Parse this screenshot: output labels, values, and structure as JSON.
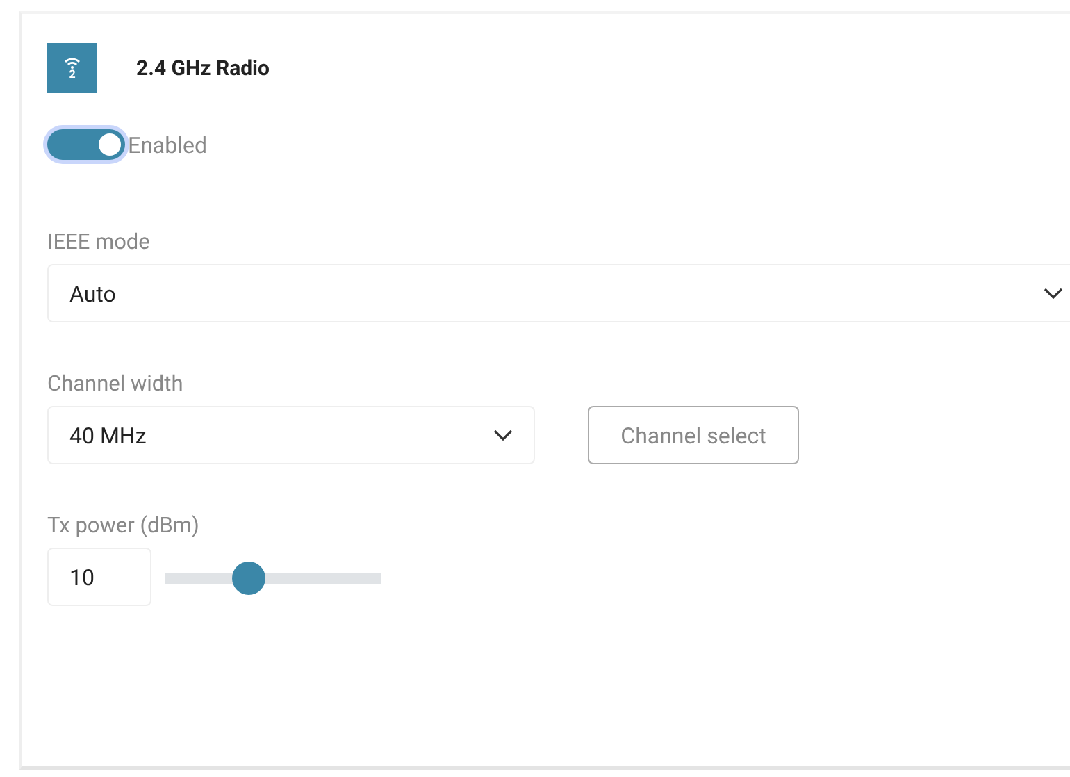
{
  "radio": {
    "icon_text": "2",
    "title": "2.4 GHz Radio"
  },
  "enabled_toggle": {
    "label": "Enabled",
    "on": true
  },
  "ieee_mode": {
    "label": "IEEE mode",
    "value": "Auto"
  },
  "channel_width": {
    "label": "Channel width",
    "value": "40 MHz"
  },
  "channel_select_button": "Channel select",
  "tx_power": {
    "label": "Tx power (dBm)",
    "value": "10",
    "level": 0.39
  }
}
